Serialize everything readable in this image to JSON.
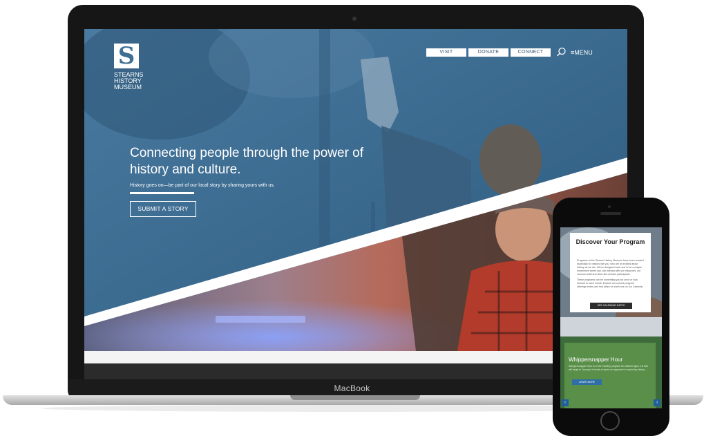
{
  "laptop": {
    "brand_label": "MacBook",
    "logo": {
      "mark": "S",
      "lines": [
        "STEARNS",
        "HISTORY",
        "MUSEUM"
      ]
    },
    "nav": {
      "visit": "VISIT",
      "donate": "DONATE",
      "connect": "CONNECT",
      "search_icon": "search-icon",
      "menu_icon": "hamburger-icon",
      "menu": "MENU"
    },
    "hero": {
      "heading": "Connecting people through the power of history and culture.",
      "subtext": "History goes on—be part of our local story by sharing yours with us.",
      "button": "SUBMIT A STORY"
    }
  },
  "phone": {
    "title": "Discover Your Program",
    "body_1": "Programs at the Stearns History Museum have been created especially for visitors like you, who are as excited about history as we are. We've designed each one to be a unique experience where you can interact with our resources, our museum staff and other like-minded participants.",
    "body_2": "These programs can be something you try once or look forward to each month. Explore our current program offerings below and find dates for each one on our Calendar.",
    "calendar_button": "SEE CALENDAR DATES",
    "feature_title": "Whippersnapper Hour",
    "feature_text": "Whippersnapper Hour is a free monthly program for children ages 2-5 that will begin in January. It meets a hands-on approach to exploring history.",
    "learn_more": "LEARN MORE",
    "prev_icon": "chevron-left-icon",
    "next_icon": "chevron-right-icon"
  },
  "colors": {
    "overlay_blue": "#3f6f92",
    "nav_text": "#3c5a78",
    "green_band": "#5a8f4a",
    "learn_blue": "#2f6fa5"
  }
}
